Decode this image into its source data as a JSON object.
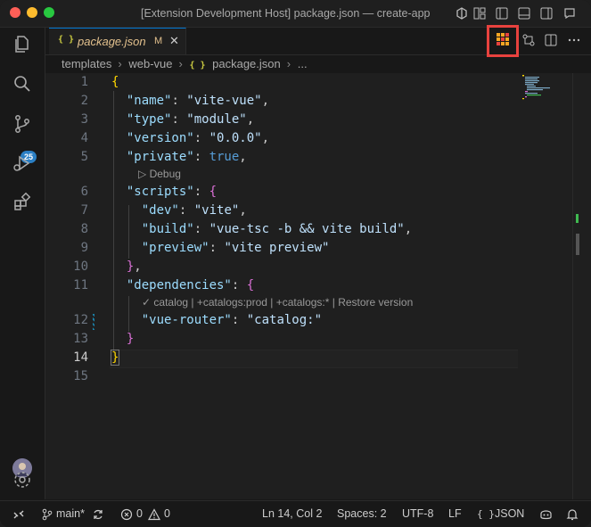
{
  "window": {
    "title": "[Extension Development Host] package.json — create-app"
  },
  "activity_bar": {
    "scm_badge": "25"
  },
  "tab": {
    "label": "package.json",
    "icon_text": "{ }",
    "modified": "M",
    "close": "✕"
  },
  "breadcrumb": {
    "items": [
      "templates",
      "web-vue",
      "package.json",
      "..."
    ],
    "json_icon": "{ }"
  },
  "editor": {
    "line_numbers": [
      "1",
      "2",
      "3",
      "4",
      "5",
      "6",
      "7",
      "8",
      "9",
      "10",
      "11",
      "12",
      "13",
      "14",
      "15"
    ],
    "codelens_debug": "▷ Debug",
    "codelens_catalog": "✓ catalog | +catalogs:prod | +catalogs:* | Restore version",
    "code": {
      "l1_open": "{",
      "name_key": "\"name\"",
      "name_val": "\"vite-vue\"",
      "type_key": "\"type\"",
      "type_val": "\"module\"",
      "version_key": "\"version\"",
      "version_val": "\"0.0.0\"",
      "private_key": "\"private\"",
      "private_val": "true",
      "scripts_key": "\"scripts\"",
      "scripts_open": "{",
      "dev_key": "\"dev\"",
      "dev_val": "\"vite\"",
      "build_key": "\"build\"",
      "build_val": "\"vue-tsc -b && vite build\"",
      "preview_key": "\"preview\"",
      "preview_val": "\"vite preview\"",
      "scripts_close": "}",
      "deps_key": "\"dependencies\"",
      "deps_open": "{",
      "router_key": "\"vue-router\"",
      "router_val": "\"catalog:\"",
      "deps_close": "}",
      "l14_close": "}"
    },
    "current_line": 14
  },
  "status_bar": {
    "branch": "main*",
    "errors": "0",
    "warnings": "0",
    "cursor": "Ln 14, Col 2",
    "spaces": "Spaces: 2",
    "encoding": "UTF-8",
    "eol": "LF",
    "language": "JSON",
    "language_icon": "{ }"
  },
  "colors": {
    "accent": "#0078d4",
    "highlight_box": "#e8423e",
    "badge": "#2b7fc4"
  }
}
